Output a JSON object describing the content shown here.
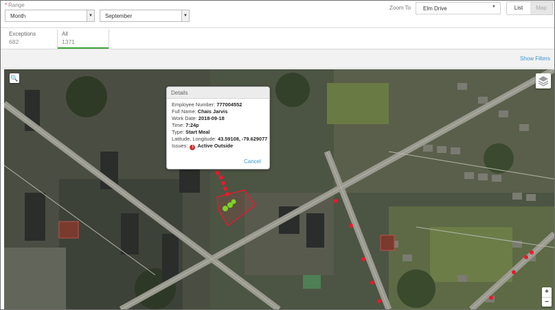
{
  "range": {
    "label": "Range",
    "required_mark": "*",
    "period": "Month",
    "month": "September"
  },
  "zoom": {
    "label": "Zoom To",
    "value": "Elm Drive"
  },
  "view_toggle": {
    "list": "List",
    "map": "Map",
    "active": "List"
  },
  "tabs": [
    {
      "label": "Exceptions",
      "count": "682"
    },
    {
      "label": "All",
      "count": "1371",
      "active": true
    }
  ],
  "filters": {
    "show_label": "Show Filters"
  },
  "details": {
    "title": "Details",
    "employee_number_label": "Employee Number:",
    "employee_number": "777004552",
    "full_name_label": "Full Name:",
    "full_name": "Chais Jarvis",
    "work_date_label": "Work Date:",
    "work_date": "2018-09-18",
    "time_label": "Time:",
    "time": "7:24p",
    "type_label": "Type:",
    "type": "Start Meal",
    "latlng_label": "Latitude, Longitude:",
    "latlng": "43.59108, -79.629077",
    "issues_label": "Issues:",
    "issues": "Active Outside",
    "cancel": "Cancel"
  },
  "map_controls": {
    "zoom_in": "+",
    "zoom_out": "−"
  },
  "colors": {
    "accent_green": "#3ca33c",
    "link_blue": "#3b95d3",
    "marker_red": "#e8192c",
    "marker_green": "#7ed321"
  }
}
